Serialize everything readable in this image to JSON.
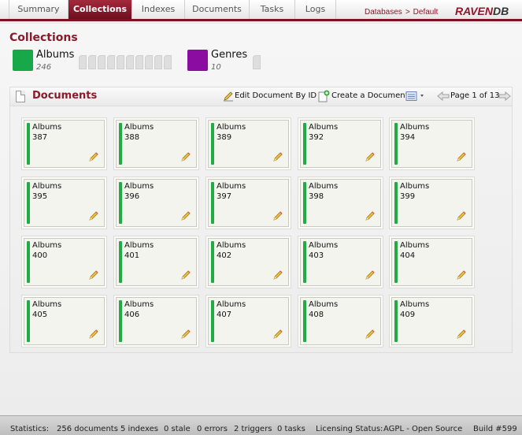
{
  "nav": {
    "tabs": [
      {
        "label": "Summary",
        "active": false
      },
      {
        "label": "Collections",
        "active": true
      },
      {
        "label": "Indexes",
        "active": false
      },
      {
        "label": "Documents",
        "active": false
      },
      {
        "label": "Tasks",
        "active": false
      },
      {
        "label": "Logs",
        "active": false
      }
    ],
    "breadcrumb": {
      "databases": "Databases",
      "separator": ">",
      "current": "Default"
    },
    "logo": {
      "brand": "RAVEN",
      "suffix": "DB"
    }
  },
  "collections": {
    "title": "Collections",
    "items": [
      {
        "name": "Albums",
        "count": "246",
        "color": "#17a84a"
      },
      {
        "name": "Genres",
        "count": "10",
        "color": "#8b0ca0"
      }
    ]
  },
  "documents_panel": {
    "title": "Documents",
    "edit_label": "Edit Document By ID",
    "create_label": "Create a Document",
    "page_label": "Page 1 of 13"
  },
  "documents": [
    {
      "collection": "Albums",
      "id": "387"
    },
    {
      "collection": "Albums",
      "id": "388"
    },
    {
      "collection": "Albums",
      "id": "389"
    },
    {
      "collection": "Albums",
      "id": "392"
    },
    {
      "collection": "Albums",
      "id": "394"
    },
    {
      "collection": "Albums",
      "id": "395"
    },
    {
      "collection": "Albums",
      "id": "396"
    },
    {
      "collection": "Albums",
      "id": "397"
    },
    {
      "collection": "Albums",
      "id": "398"
    },
    {
      "collection": "Albums",
      "id": "399"
    },
    {
      "collection": "Albums",
      "id": "400"
    },
    {
      "collection": "Albums",
      "id": "401"
    },
    {
      "collection": "Albums",
      "id": "402"
    },
    {
      "collection": "Albums",
      "id": "403"
    },
    {
      "collection": "Albums",
      "id": "404"
    },
    {
      "collection": "Albums",
      "id": "405"
    },
    {
      "collection": "Albums",
      "id": "406"
    },
    {
      "collection": "Albums",
      "id": "407"
    },
    {
      "collection": "Albums",
      "id": "408"
    },
    {
      "collection": "Albums",
      "id": "409"
    }
  ],
  "statusbar": {
    "label": "Statistics:",
    "documents": "256 documents",
    "indexes": "5 indexes",
    "stale": "0 stale",
    "errors": "0 errors",
    "triggers": "2 triggers",
    "tasks": "0 tasks",
    "licensing": "Licensing Status:",
    "license": "AGPL - Open Source",
    "build": "Build #599"
  },
  "colors": {
    "accent": "#8b1a2b",
    "doc_bar": "#22aa44"
  }
}
